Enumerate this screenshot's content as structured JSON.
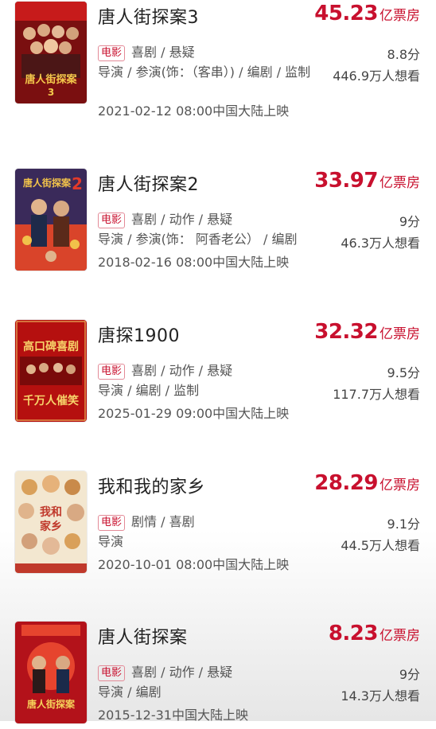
{
  "movies": [
    {
      "title": "唐人街探案3",
      "box_number": "45.23",
      "box_unit": "亿票房",
      "badge": "电影",
      "genres": "喜剧 / 悬疑",
      "score": "8.8分",
      "cast": "导演 / 参演(饰：（客串）) / 编剧 / 监制",
      "want": "446.9万人想看",
      "release": "2021-02-12 08:00中国大陆上映",
      "poster_colors": [
        "#7a0f10",
        "#c71b1b",
        "#e8b04a"
      ]
    },
    {
      "title": "唐人街探案2",
      "box_number": "33.97",
      "box_unit": "亿票房",
      "badge": "电影",
      "genres": "喜剧 / 动作 / 悬疑",
      "score": "9分",
      "cast": "导演 / 参演(饰： 阿香老公） / 编剧",
      "want": "46.3万人想看",
      "release": "2018-02-16 08:00中国大陆上映",
      "poster_colors": [
        "#3a2a5a",
        "#d9442a",
        "#f1c24a"
      ]
    },
    {
      "title": "唐探1900",
      "box_number": "32.32",
      "box_unit": "亿票房",
      "badge": "电影",
      "genres": "喜剧 / 动作 / 悬疑",
      "score": "9.5分",
      "cast": "导演 / 编剧 / 监制",
      "want": "117.7万人想看",
      "release": "2025-01-29 09:00中国大陆上映",
      "poster_colors": [
        "#b5100f",
        "#e0231e",
        "#f7d36a"
      ],
      "poster_text_top": "高口碑喜剧",
      "poster_text_bottom": "千万人催笑"
    },
    {
      "title": "我和我的家乡",
      "box_number": "28.29",
      "box_unit": "亿票房",
      "badge": "电影",
      "genres": "剧情 / 喜剧",
      "score": "9.1分",
      "cast": "导演",
      "want": "44.5万人想看",
      "release": "2020-10-01 08:00中国大陆上映",
      "poster_colors": [
        "#f3e7d0",
        "#d98a2b",
        "#c0392b"
      ]
    },
    {
      "title": "唐人街探案",
      "box_number": "8.23",
      "box_unit": "亿票房",
      "badge": "电影",
      "genres": "喜剧 / 动作 / 悬疑",
      "score": "9分",
      "cast": "导演 / 编剧",
      "want": "14.3万人想看",
      "release": "2015-12-31中国大陆上映",
      "poster_colors": [
        "#b3121a",
        "#e6442e",
        "#f5d25a"
      ]
    }
  ]
}
